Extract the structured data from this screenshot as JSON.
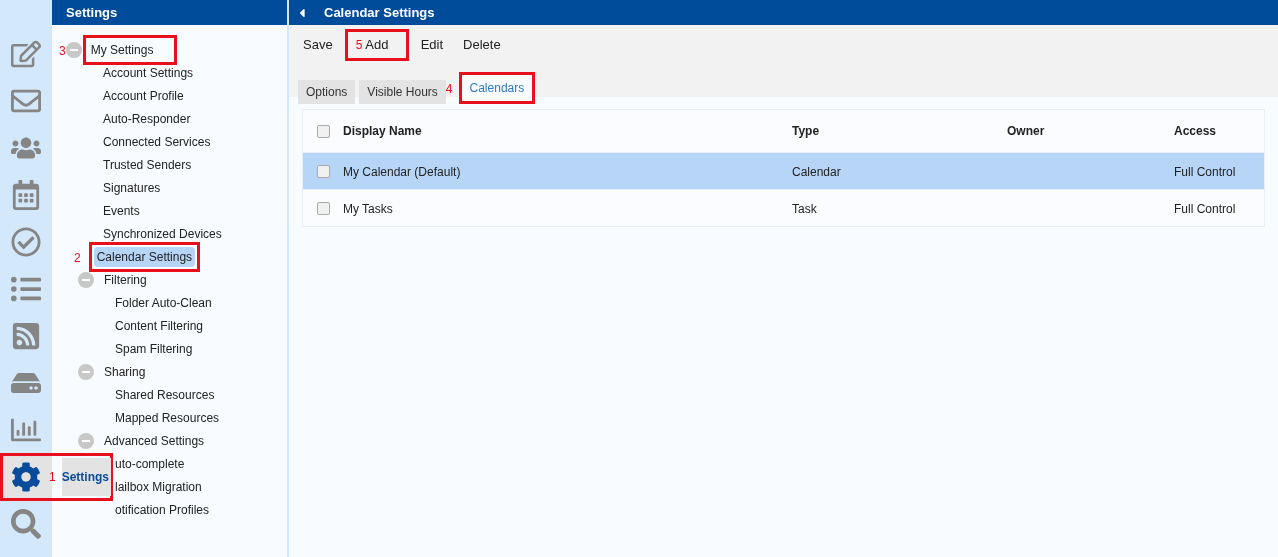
{
  "rail": {
    "items": [
      {
        "selected": false
      },
      {
        "selected": false
      },
      {
        "selected": false
      },
      {
        "selected": false
      },
      {
        "selected": false
      },
      {
        "selected": false
      },
      {
        "selected": false
      },
      {
        "selected": false
      },
      {
        "selected": false
      },
      {
        "selected": true,
        "label": "Settings",
        "callout": "1"
      },
      {
        "selected": false
      }
    ]
  },
  "sidebar": {
    "title": "Settings",
    "tree": [
      {
        "label": "My Settings",
        "expanded": true,
        "selected": false,
        "callout": "3",
        "children": [
          {
            "label": "Account Settings",
            "selected": false
          },
          {
            "label": "Account Profile",
            "selected": false
          },
          {
            "label": "Auto-Responder",
            "selected": false
          },
          {
            "label": "Connected Services",
            "selected": false
          },
          {
            "label": "Trusted Senders",
            "selected": false
          },
          {
            "label": "Signatures",
            "selected": false
          },
          {
            "label": "Events",
            "selected": false
          },
          {
            "label": "Synchronized Devices",
            "selected": false
          },
          {
            "label": "Calendar Settings",
            "selected": true,
            "callout": "2"
          },
          {
            "label": "Filtering",
            "expanded": true,
            "selected": false,
            "children": [
              {
                "label": "Folder Auto-Clean",
                "selected": false
              },
              {
                "label": "Content Filtering",
                "selected": false
              },
              {
                "label": "Spam Filtering",
                "selected": false
              }
            ]
          },
          {
            "label": "Sharing",
            "expanded": true,
            "selected": false,
            "children": [
              {
                "label": "Shared Resources",
                "selected": false
              },
              {
                "label": "Mapped Resources",
                "selected": false
              }
            ]
          },
          {
            "label": "Advanced Settings",
            "expanded": true,
            "selected": false,
            "children": [
              {
                "label": "uto-complete",
                "selected": false
              },
              {
                "label": "lailbox Migration",
                "selected": false
              },
              {
                "label": "otification Profiles",
                "selected": false
              }
            ]
          }
        ]
      }
    ]
  },
  "main": {
    "title": "Calendar Settings",
    "toolbar": [
      {
        "label": "Save"
      },
      {
        "label": "Add",
        "callout": "5"
      },
      {
        "label": "Edit"
      },
      {
        "label": "Delete"
      }
    ],
    "tabs": [
      {
        "label": "Options",
        "selected": false
      },
      {
        "label": "Visible Hours",
        "selected": false
      },
      {
        "label": "Calendars",
        "selected": true,
        "callout": "4"
      }
    ],
    "table": {
      "columns": [
        "Display Name",
        "Type",
        "Owner",
        "Access"
      ],
      "header_checked": false,
      "rows": [
        {
          "cells": [
            "My Calendar (Default)",
            "Calendar",
            "",
            "Full Control"
          ],
          "selected": true,
          "checked": false
        },
        {
          "cells": [
            "My Tasks",
            "Task",
            "",
            "Full Control"
          ],
          "selected": false,
          "checked": false
        }
      ]
    }
  }
}
